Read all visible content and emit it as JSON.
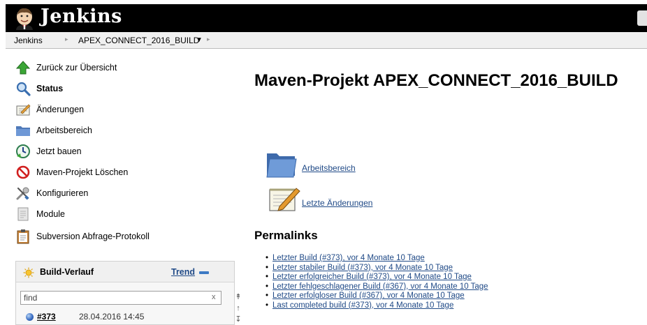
{
  "app": {
    "brand": "Jenkins"
  },
  "breadcrumb": {
    "items": [
      "Jenkins",
      "APEX_CONNECT_2016_BUILD"
    ]
  },
  "sidebar": {
    "tasks": [
      {
        "label": "Zurück zur Übersicht",
        "icon": "up-arrow-icon"
      },
      {
        "label": "Status",
        "icon": "magnifier-icon"
      },
      {
        "label": "Änderungen",
        "icon": "notepad-icon"
      },
      {
        "label": "Arbeitsbereich",
        "icon": "folder-icon"
      },
      {
        "label": "Jetzt bauen",
        "icon": "clock-icon"
      },
      {
        "label": "Maven-Projekt Löschen",
        "icon": "no-entry-icon"
      },
      {
        "label": "Konfigurieren",
        "icon": "wrench-icon"
      },
      {
        "label": "Module",
        "icon": "document-icon"
      },
      {
        "label": "Subversion Abfrage-Protokoll",
        "icon": "clipboard-icon"
      }
    ]
  },
  "build_history": {
    "title": "Build-Verlauf",
    "trend_label": "Trend",
    "search_value": "find",
    "clear_label": "x",
    "builds": [
      {
        "number": "#373",
        "date": "28.04.2016 14:45"
      }
    ]
  },
  "main": {
    "title": "Maven-Projekt APEX_CONNECT_2016_BUILD",
    "links": [
      {
        "label": "Arbeitsbereich",
        "icon": "folder-icon"
      },
      {
        "label": "Letzte Änderungen",
        "icon": "notepad-icon"
      }
    ],
    "permalinks_title": "Permalinks",
    "permalinks": [
      "Letzter Build (#373), vor 4 Monate 10 Tage",
      "Letzter stabiler Build (#373), vor 4 Monate 10 Tage",
      "Letzter erfolgreicher Build (#373), vor 4 Monate 10 Tage",
      "Letzter fehlgeschlagener Build (#367), vor 4 Monate 10 Tage",
      "Letzter erfolgloser Build (#367), vor 4 Monate 10 Tage",
      "Last completed build (#373), vor 4 Monate 10 Tage"
    ]
  },
  "colors": {
    "header_bg": "#000000",
    "link": "#204a87",
    "build_ball": "#3b6fc4"
  }
}
